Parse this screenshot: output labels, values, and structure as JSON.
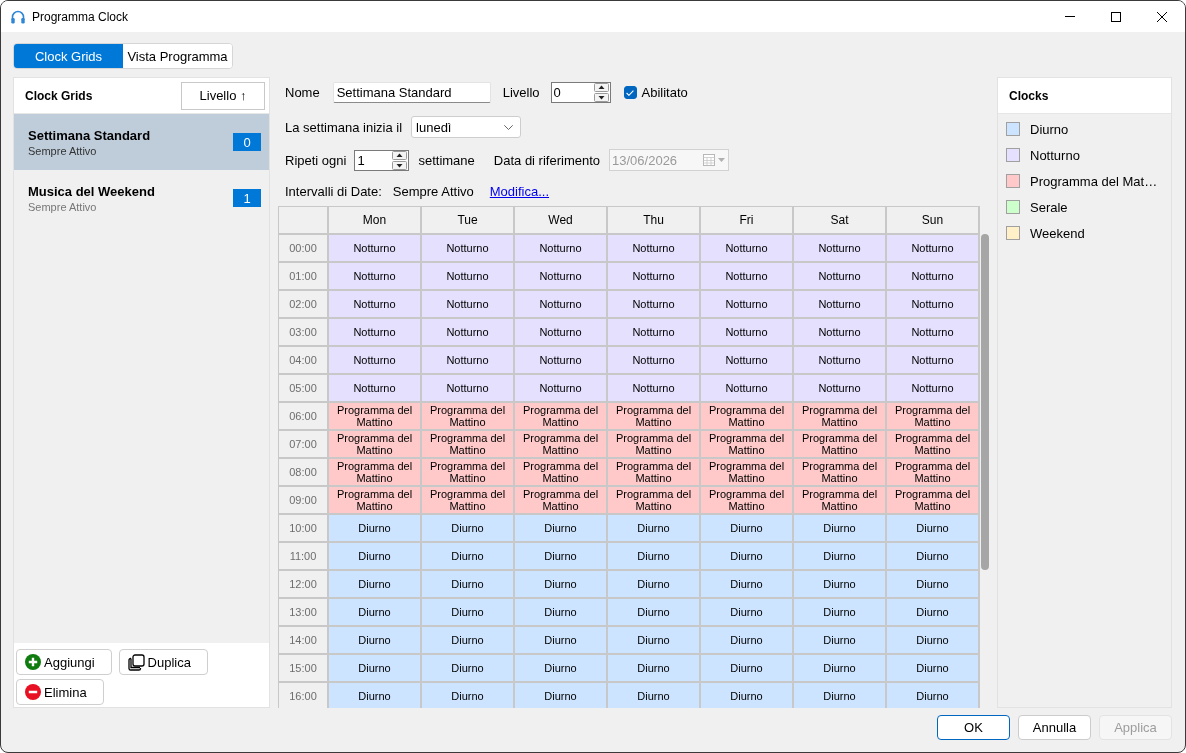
{
  "window": {
    "title": "Programma Clock"
  },
  "tabs": [
    {
      "label": "Clock Grids",
      "selected": true
    },
    {
      "label": "Vista Programma",
      "selected": false
    }
  ],
  "grid_list": {
    "title": "Clock Grids",
    "sort_button": "Livello ↑",
    "items": [
      {
        "name": "Settimana Standard",
        "subtitle": "Sempre Attivo",
        "badge": "0",
        "selected": true
      },
      {
        "name": "Musica del Weekend",
        "subtitle": "Sempre Attivo",
        "badge": "1",
        "selected": false
      }
    ],
    "buttons": [
      {
        "kind": "add",
        "label": "Aggiungi"
      },
      {
        "kind": "duplicate",
        "label": "Duplica"
      },
      {
        "kind": "delete",
        "label": "Elimina"
      }
    ]
  },
  "form": {
    "name": {
      "label": "Nome",
      "value": "Settimana Standard"
    },
    "level_setting": {
      "label": "Livello",
      "value": "0"
    },
    "enabled": {
      "label": "Abilitato",
      "checked": true
    },
    "week_start": {
      "label": "La settimana inizia il",
      "value": "lunedì"
    },
    "repeat": {
      "label": "Ripeti ogni",
      "value": "1",
      "unit": "settimane"
    },
    "reference_date": {
      "label": "Data di riferimento",
      "value": "13/06/2026",
      "disabled": true
    },
    "date_ranges": {
      "label": "Intervalli di Date:",
      "value": "Sempre Attivo",
      "link": "Modifica..."
    }
  },
  "schedule": {
    "columns": [
      "Mon",
      "Tue",
      "Wed",
      "Thu",
      "Fri",
      "Sat",
      "Sun"
    ],
    "rows": [
      {
        "time": "00:00",
        "cells": [
          {
            "text": "Notturno",
            "color": "#e6e0ff"
          },
          {
            "text": "Notturno",
            "color": "#e6e0ff"
          },
          {
            "text": "Notturno",
            "color": "#e6e0ff"
          },
          {
            "text": "Notturno",
            "color": "#e6e0ff"
          },
          {
            "text": "Notturno",
            "color": "#e6e0ff"
          },
          {
            "text": "Notturno",
            "color": "#e6e0ff"
          },
          {
            "text": "Notturno",
            "color": "#e6e0ff"
          }
        ]
      },
      {
        "time": "01:00",
        "cells": [
          {
            "text": "Notturno",
            "color": "#e6e0ff"
          },
          {
            "text": "Notturno",
            "color": "#e6e0ff"
          },
          {
            "text": "Notturno",
            "color": "#e6e0ff"
          },
          {
            "text": "Notturno",
            "color": "#e6e0ff"
          },
          {
            "text": "Notturno",
            "color": "#e6e0ff"
          },
          {
            "text": "Notturno",
            "color": "#e6e0ff"
          },
          {
            "text": "Notturno",
            "color": "#e6e0ff"
          }
        ]
      },
      {
        "time": "02:00",
        "cells": [
          {
            "text": "Notturno",
            "color": "#e6e0ff"
          },
          {
            "text": "Notturno",
            "color": "#e6e0ff"
          },
          {
            "text": "Notturno",
            "color": "#e6e0ff"
          },
          {
            "text": "Notturno",
            "color": "#e6e0ff"
          },
          {
            "text": "Notturno",
            "color": "#e6e0ff"
          },
          {
            "text": "Notturno",
            "color": "#e6e0ff"
          },
          {
            "text": "Notturno",
            "color": "#e6e0ff"
          }
        ]
      },
      {
        "time": "03:00",
        "cells": [
          {
            "text": "Notturno",
            "color": "#e6e0ff"
          },
          {
            "text": "Notturno",
            "color": "#e6e0ff"
          },
          {
            "text": "Notturno",
            "color": "#e6e0ff"
          },
          {
            "text": "Notturno",
            "color": "#e6e0ff"
          },
          {
            "text": "Notturno",
            "color": "#e6e0ff"
          },
          {
            "text": "Notturno",
            "color": "#e6e0ff"
          },
          {
            "text": "Notturno",
            "color": "#e6e0ff"
          }
        ]
      },
      {
        "time": "04:00",
        "cells": [
          {
            "text": "Notturno",
            "color": "#e6e0ff"
          },
          {
            "text": "Notturno",
            "color": "#e6e0ff"
          },
          {
            "text": "Notturno",
            "color": "#e6e0ff"
          },
          {
            "text": "Notturno",
            "color": "#e6e0ff"
          },
          {
            "text": "Notturno",
            "color": "#e6e0ff"
          },
          {
            "text": "Notturno",
            "color": "#e6e0ff"
          },
          {
            "text": "Notturno",
            "color": "#e6e0ff"
          }
        ]
      },
      {
        "time": "05:00",
        "cells": [
          {
            "text": "Notturno",
            "color": "#e6e0ff"
          },
          {
            "text": "Notturno",
            "color": "#e6e0ff"
          },
          {
            "text": "Notturno",
            "color": "#e6e0ff"
          },
          {
            "text": "Notturno",
            "color": "#e6e0ff"
          },
          {
            "text": "Notturno",
            "color": "#e6e0ff"
          },
          {
            "text": "Notturno",
            "color": "#e6e0ff"
          },
          {
            "text": "Notturno",
            "color": "#e6e0ff"
          }
        ]
      },
      {
        "time": "06:00",
        "cells": [
          {
            "text": "Programma del Mattino",
            "color": "#ffc9c9"
          },
          {
            "text": "Programma del Mattino",
            "color": "#ffc9c9"
          },
          {
            "text": "Programma del Mattino",
            "color": "#ffc9c9"
          },
          {
            "text": "Programma del Mattino",
            "color": "#ffc9c9"
          },
          {
            "text": "Programma del Mattino",
            "color": "#ffc9c9"
          },
          {
            "text": "Programma del Mattino",
            "color": "#ffc9c9"
          },
          {
            "text": "Programma del Mattino",
            "color": "#ffc9c9"
          }
        ]
      },
      {
        "time": "07:00",
        "cells": [
          {
            "text": "Programma del Mattino",
            "color": "#ffc9c9"
          },
          {
            "text": "Programma del Mattino",
            "color": "#ffc9c9"
          },
          {
            "text": "Programma del Mattino",
            "color": "#ffc9c9"
          },
          {
            "text": "Programma del Mattino",
            "color": "#ffc9c9"
          },
          {
            "text": "Programma del Mattino",
            "color": "#ffc9c9"
          },
          {
            "text": "Programma del Mattino",
            "color": "#ffc9c9"
          },
          {
            "text": "Programma del Mattino",
            "color": "#ffc9c9"
          }
        ]
      },
      {
        "time": "08:00",
        "cells": [
          {
            "text": "Programma del Mattino",
            "color": "#ffc9c9"
          },
          {
            "text": "Programma del Mattino",
            "color": "#ffc9c9"
          },
          {
            "text": "Programma del Mattino",
            "color": "#ffc9c9"
          },
          {
            "text": "Programma del Mattino",
            "color": "#ffc9c9"
          },
          {
            "text": "Programma del Mattino",
            "color": "#ffc9c9"
          },
          {
            "text": "Programma del Mattino",
            "color": "#ffc9c9"
          },
          {
            "text": "Programma del Mattino",
            "color": "#ffc9c9"
          }
        ]
      },
      {
        "time": "09:00",
        "cells": [
          {
            "text": "Programma del Mattino",
            "color": "#ffc9c9"
          },
          {
            "text": "Programma del Mattino",
            "color": "#ffc9c9"
          },
          {
            "text": "Programma del Mattino",
            "color": "#ffc9c9"
          },
          {
            "text": "Programma del Mattino",
            "color": "#ffc9c9"
          },
          {
            "text": "Programma del Mattino",
            "color": "#ffc9c9"
          },
          {
            "text": "Programma del Mattino",
            "color": "#ffc9c9"
          },
          {
            "text": "Programma del Mattino",
            "color": "#ffc9c9"
          }
        ]
      },
      {
        "time": "10:00",
        "cells": [
          {
            "text": "Diurno",
            "color": "#cce4ff"
          },
          {
            "text": "Diurno",
            "color": "#cce4ff"
          },
          {
            "text": "Diurno",
            "color": "#cce4ff"
          },
          {
            "text": "Diurno",
            "color": "#cce4ff"
          },
          {
            "text": "Diurno",
            "color": "#cce4ff"
          },
          {
            "text": "Diurno",
            "color": "#cce4ff"
          },
          {
            "text": "Diurno",
            "color": "#cce4ff"
          }
        ]
      },
      {
        "time": "11:00",
        "cells": [
          {
            "text": "Diurno",
            "color": "#cce4ff"
          },
          {
            "text": "Diurno",
            "color": "#cce4ff"
          },
          {
            "text": "Diurno",
            "color": "#cce4ff"
          },
          {
            "text": "Diurno",
            "color": "#cce4ff"
          },
          {
            "text": "Diurno",
            "color": "#cce4ff"
          },
          {
            "text": "Diurno",
            "color": "#cce4ff"
          },
          {
            "text": "Diurno",
            "color": "#cce4ff"
          }
        ]
      },
      {
        "time": "12:00",
        "cells": [
          {
            "text": "Diurno",
            "color": "#cce4ff"
          },
          {
            "text": "Diurno",
            "color": "#cce4ff"
          },
          {
            "text": "Diurno",
            "color": "#cce4ff"
          },
          {
            "text": "Diurno",
            "color": "#cce4ff"
          },
          {
            "text": "Diurno",
            "color": "#cce4ff"
          },
          {
            "text": "Diurno",
            "color": "#cce4ff"
          },
          {
            "text": "Diurno",
            "color": "#cce4ff"
          }
        ]
      },
      {
        "time": "13:00",
        "cells": [
          {
            "text": "Diurno",
            "color": "#cce4ff"
          },
          {
            "text": "Diurno",
            "color": "#cce4ff"
          },
          {
            "text": "Diurno",
            "color": "#cce4ff"
          },
          {
            "text": "Diurno",
            "color": "#cce4ff"
          },
          {
            "text": "Diurno",
            "color": "#cce4ff"
          },
          {
            "text": "Diurno",
            "color": "#cce4ff"
          },
          {
            "text": "Diurno",
            "color": "#cce4ff"
          }
        ]
      },
      {
        "time": "14:00",
        "cells": [
          {
            "text": "Diurno",
            "color": "#cce4ff"
          },
          {
            "text": "Diurno",
            "color": "#cce4ff"
          },
          {
            "text": "Diurno",
            "color": "#cce4ff"
          },
          {
            "text": "Diurno",
            "color": "#cce4ff"
          },
          {
            "text": "Diurno",
            "color": "#cce4ff"
          },
          {
            "text": "Diurno",
            "color": "#cce4ff"
          },
          {
            "text": "Diurno",
            "color": "#cce4ff"
          }
        ]
      },
      {
        "time": "15:00",
        "cells": [
          {
            "text": "Diurno",
            "color": "#cce4ff"
          },
          {
            "text": "Diurno",
            "color": "#cce4ff"
          },
          {
            "text": "Diurno",
            "color": "#cce4ff"
          },
          {
            "text": "Diurno",
            "color": "#cce4ff"
          },
          {
            "text": "Diurno",
            "color": "#cce4ff"
          },
          {
            "text": "Diurno",
            "color": "#cce4ff"
          },
          {
            "text": "Diurno",
            "color": "#cce4ff"
          }
        ]
      },
      {
        "time": "16:00",
        "cells": [
          {
            "text": "Diurno",
            "color": "#cce4ff"
          },
          {
            "text": "Diurno",
            "color": "#cce4ff"
          },
          {
            "text": "Diurno",
            "color": "#cce4ff"
          },
          {
            "text": "Diurno",
            "color": "#cce4ff"
          },
          {
            "text": "Diurno",
            "color": "#cce4ff"
          },
          {
            "text": "Diurno",
            "color": "#cce4ff"
          },
          {
            "text": "Diurno",
            "color": "#cce4ff"
          }
        ]
      }
    ]
  },
  "clocks": {
    "title": "Clocks",
    "items": [
      {
        "name": "Diurno",
        "color": "#cce4ff"
      },
      {
        "name": "Notturno",
        "color": "#e6e0ff"
      },
      {
        "name": "Programma del Mat…",
        "color": "#ffc9c9"
      },
      {
        "name": "Serale",
        "color": "#ccffcc"
      },
      {
        "name": "Weekend",
        "color": "#fff0c8"
      }
    ]
  },
  "buttons": [
    {
      "label": "OK",
      "default": true,
      "disabled": false
    },
    {
      "label": "Annulla",
      "default": false,
      "disabled": false
    },
    {
      "label": "Applica",
      "default": false,
      "disabled": true
    }
  ]
}
